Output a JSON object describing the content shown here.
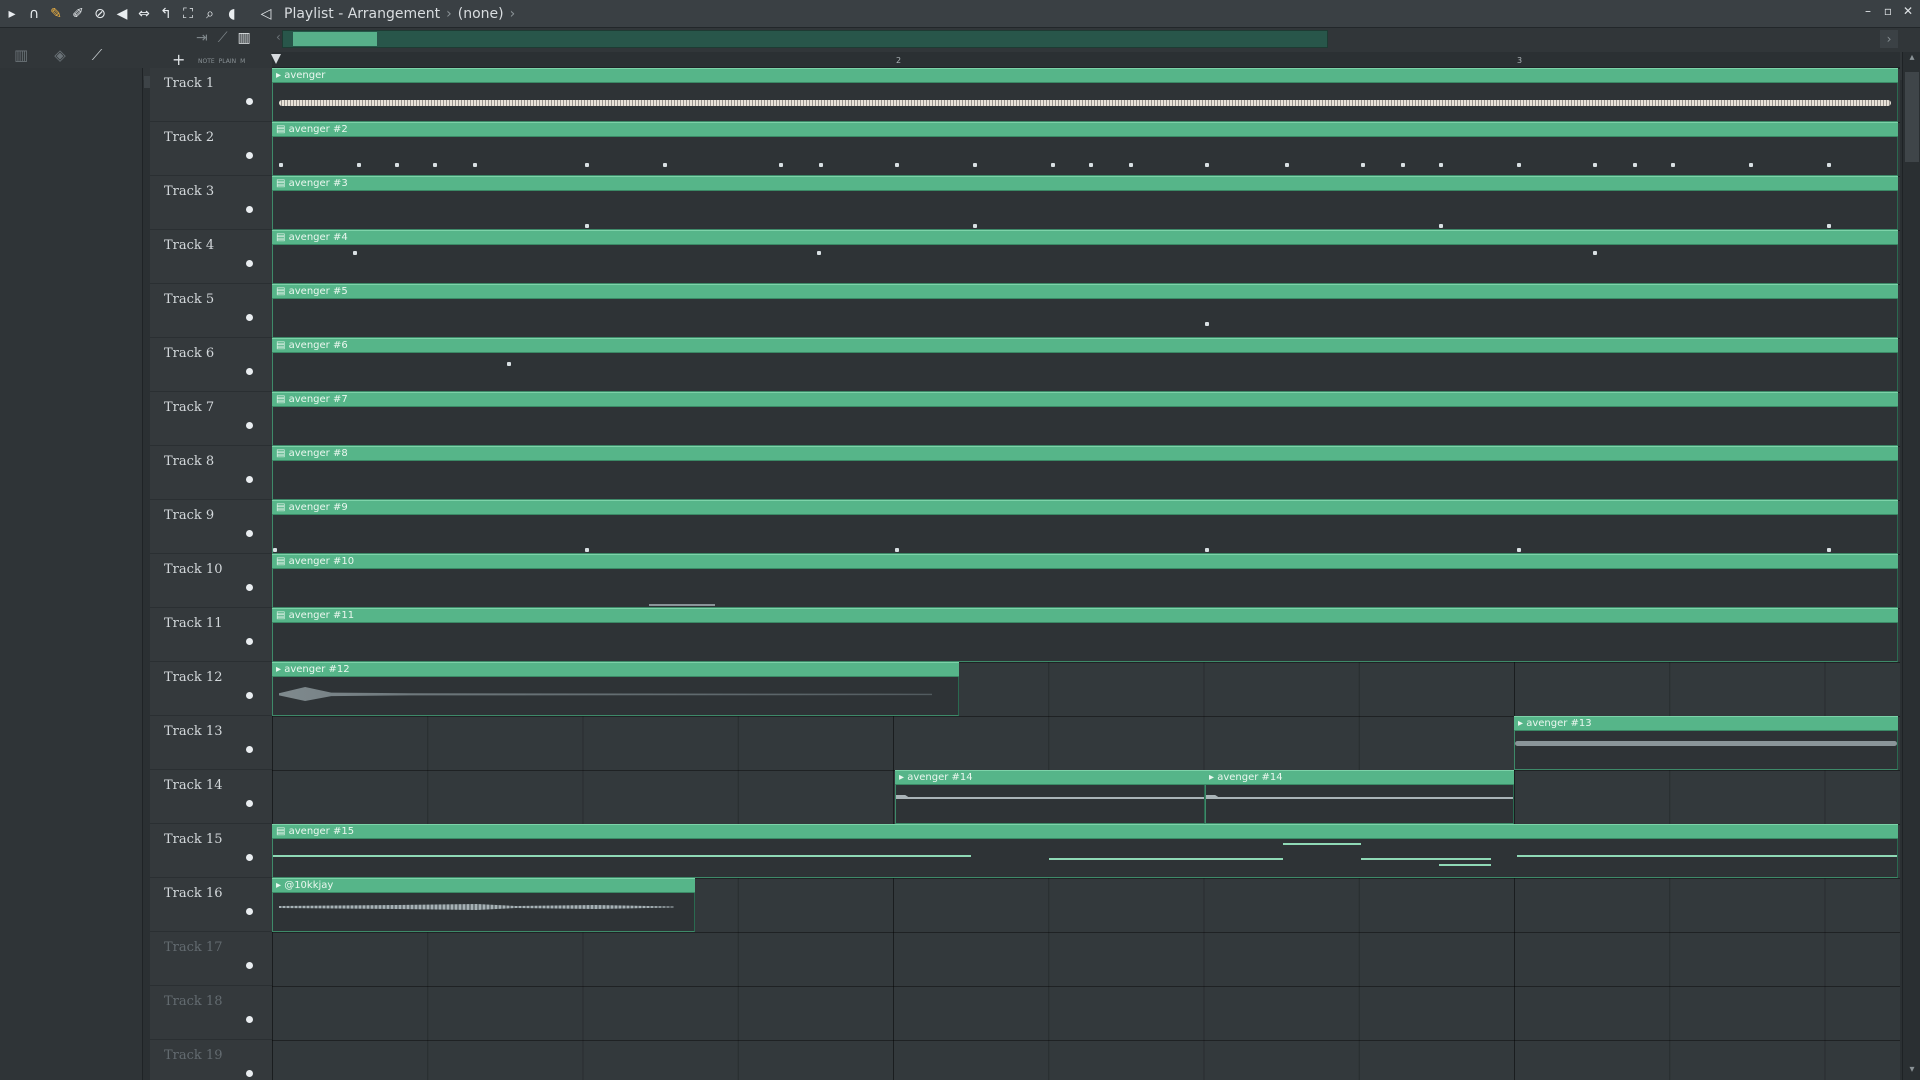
{
  "window": {
    "title": "Playlist - Arrangement",
    "pattern": "(none)",
    "controls": [
      "minimize",
      "maximize",
      "close"
    ]
  },
  "toolbar": {
    "icons": [
      "menu-arrow-icon",
      "magnet-icon",
      "draw-icon",
      "paint-icon",
      "delete-icon",
      "mute-icon",
      "slip-icon",
      "select-icon",
      "zoom-icon",
      "playback-icon"
    ],
    "add_track": "+",
    "tiny_labels": [
      "NOTE",
      "PLAIN",
      "M"
    ]
  },
  "ruler": {
    "bars": [
      "2",
      "3"
    ]
  },
  "tracks": [
    {
      "name": "Track 1"
    },
    {
      "name": "Track 2"
    },
    {
      "name": "Track 3"
    },
    {
      "name": "Track 4"
    },
    {
      "name": "Track 5"
    },
    {
      "name": "Track 6"
    },
    {
      "name": "Track 7"
    },
    {
      "name": "Track 8"
    },
    {
      "name": "Track 9"
    },
    {
      "name": "Track 10"
    },
    {
      "name": "Track 11"
    },
    {
      "name": "Track 12"
    },
    {
      "name": "Track 13"
    },
    {
      "name": "Track 14"
    },
    {
      "name": "Track 15"
    },
    {
      "name": "Track 16"
    },
    {
      "name": "Track 17"
    },
    {
      "name": "Track 18"
    },
    {
      "name": "Track 19"
    }
  ],
  "clips": [
    {
      "label": "avenger",
      "kind": "audio"
    },
    {
      "label": "avenger #2",
      "kind": "pattern"
    },
    {
      "label": "avenger #3",
      "kind": "pattern"
    },
    {
      "label": "avenger #4",
      "kind": "pattern"
    },
    {
      "label": "avenger #5",
      "kind": "pattern"
    },
    {
      "label": "avenger #6",
      "kind": "pattern"
    },
    {
      "label": "avenger #7",
      "kind": "pattern"
    },
    {
      "label": "avenger #8",
      "kind": "pattern"
    },
    {
      "label": "avenger #9",
      "kind": "pattern"
    },
    {
      "label": "avenger #10",
      "kind": "pattern"
    },
    {
      "label": "avenger #11",
      "kind": "pattern"
    },
    {
      "label": "avenger #12",
      "kind": "audio"
    },
    {
      "label": "avenger #13",
      "kind": "audio"
    },
    {
      "label": "avenger #14",
      "kind": "audio"
    },
    {
      "label": "avenger #14",
      "kind": "audio"
    },
    {
      "label": "avenger #15",
      "kind": "pattern"
    },
    {
      "label": "@10kkjay",
      "kind": "audio"
    }
  ],
  "colors": {
    "clip": "#56b589",
    "background": "#33393c",
    "accent": "#f0b343"
  }
}
